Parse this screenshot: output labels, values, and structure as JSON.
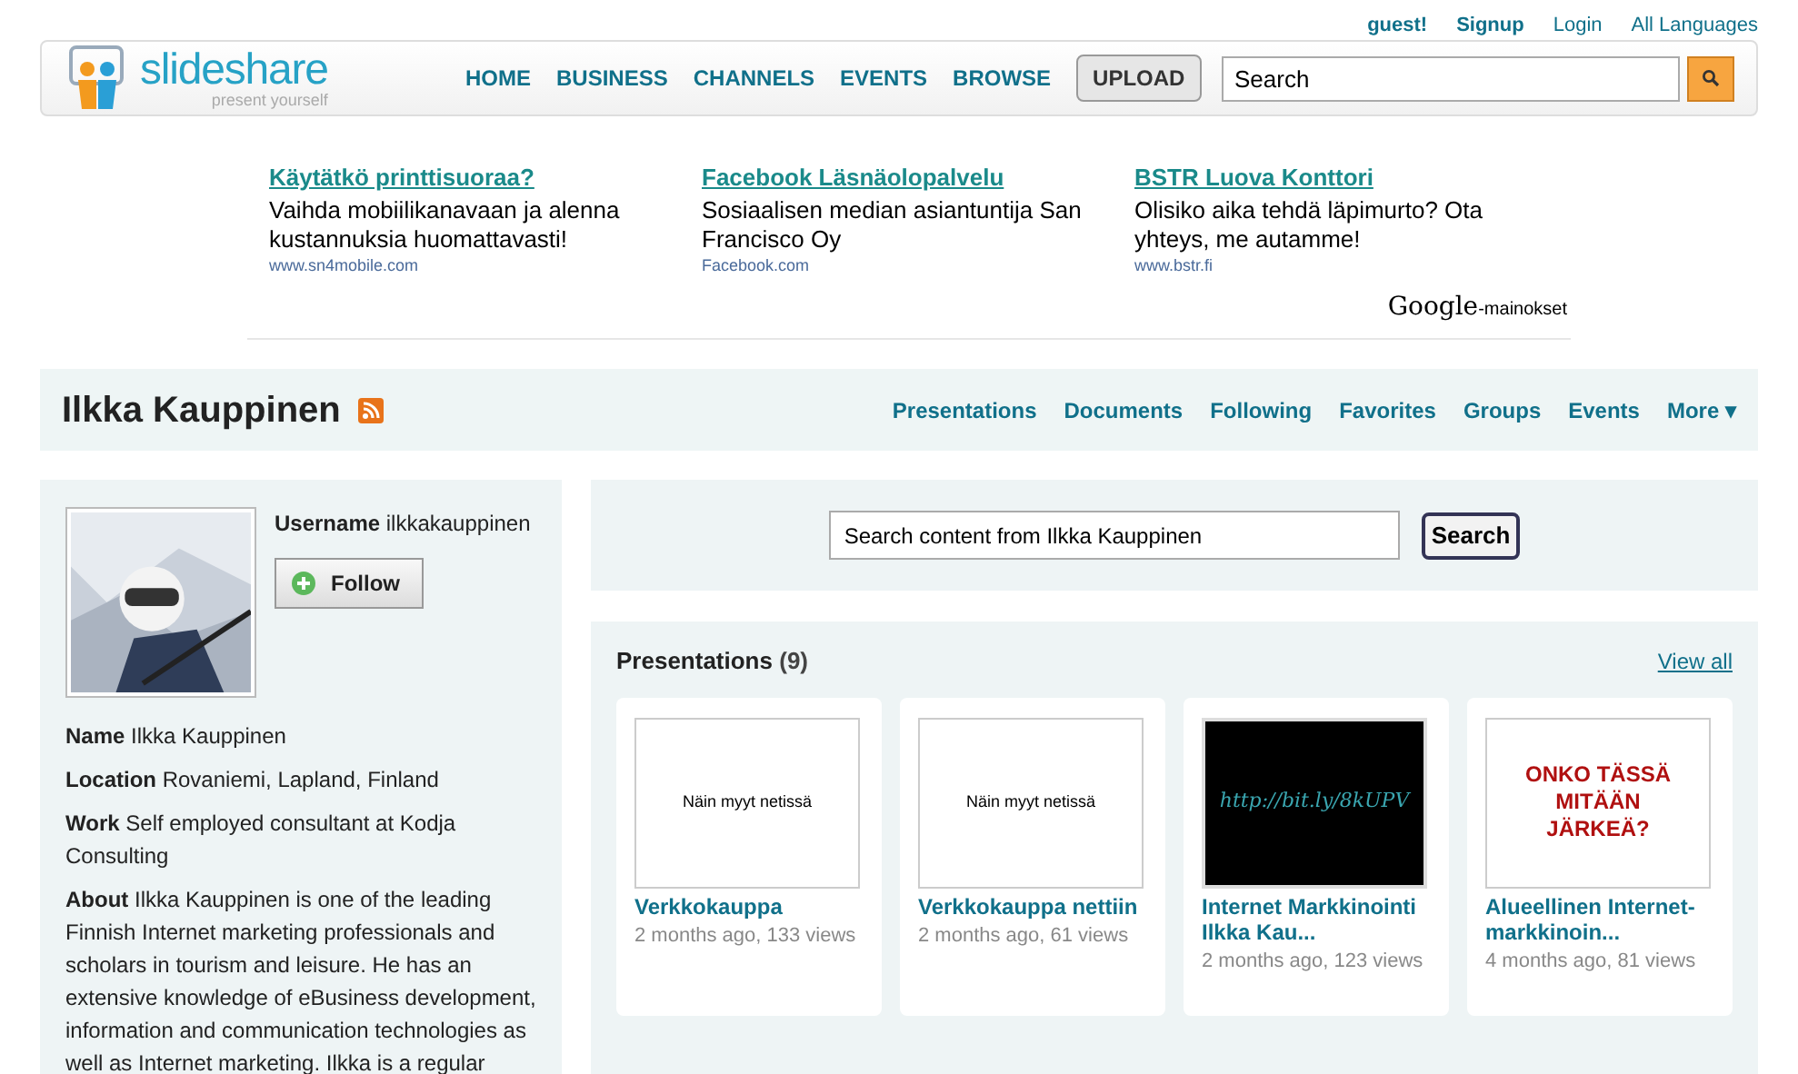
{
  "top_links": [
    {
      "label": "guest!",
      "kind": "bold"
    },
    {
      "label": "Signup",
      "kind": "bold"
    },
    {
      "label": "Login",
      "kind": "plain"
    },
    {
      "label": "All Languages",
      "kind": "plain"
    }
  ],
  "logo": {
    "name": "slideshare",
    "tagline": "present yourself"
  },
  "nav": [
    "HOME",
    "BUSINESS",
    "CHANNELS",
    "EVENTS",
    "BROWSE"
  ],
  "upload": "UPLOAD",
  "search": {
    "value": "Search"
  },
  "ads": [
    {
      "title": "Käytätkö printtisuoraa?",
      "text": "Vaihda mobiilikanavaan ja alenna kustannuksia huomattavasti!",
      "url": "www.sn4mobile.com"
    },
    {
      "title": "Facebook Läsnäolopalvelu",
      "text": "Sosiaalisen median asiantuntija San Francisco Oy",
      "url": "Facebook.com"
    },
    {
      "title": "BSTR Luova Konttori",
      "text": "Olisiko aika tehdä läpimurto? Ota yhteys, me autamme!",
      "url": "www.bstr.fi"
    }
  ],
  "ads_credit": {
    "brand": "Google",
    "suffix": "-mainokset"
  },
  "profile": {
    "name": "Ilkka Kauppinen",
    "tabs": [
      "Presentations",
      "Documents",
      "Following",
      "Favorites",
      "Groups",
      "Events",
      "More ▾"
    ]
  },
  "user": {
    "username_label": "Username",
    "username": "ilkkakauppinen",
    "follow": "Follow",
    "fields": [
      {
        "label": "Name",
        "value": "Ilkka Kauppinen"
      },
      {
        "label": "Location",
        "value": "Rovaniemi, Lapland, Finland"
      },
      {
        "label": "Work",
        "value": "Self employed consultant at Kodja Consulting"
      },
      {
        "label": "About",
        "value": "Ilkka Kauppinen is one of the leading Finnish Internet marketing professionals and scholars in tourism and leisure. He has an extensive knowledge of eBusiness development, information and communication technologies as well as Internet marketing. Ilkka is a regular"
      }
    ]
  },
  "content_search": {
    "value": "Search content from Ilkka Kauppinen",
    "button": "Search"
  },
  "presentations": {
    "title": "Presentations",
    "count": "(9)",
    "view_all": "View all",
    "items": [
      {
        "title": "Verkkokauppa",
        "meta": "2 months ago, 133 views",
        "slide": {
          "kind": "plain",
          "text": "Näin myyt netissä"
        }
      },
      {
        "title": "Verkkokauppa nettiin",
        "meta": "2 months ago, 61 views",
        "slide": {
          "kind": "plain",
          "text": "Näin myyt netissä"
        }
      },
      {
        "title": "Internet Markkinointi Ilkka Kau...",
        "meta": "2 months ago, 123 views",
        "slide": {
          "kind": "dark",
          "text": "http://bit.ly/8kUPV"
        }
      },
      {
        "title": "Alueellinen Internet-markkinoin...",
        "meta": "4 months ago, 81 views",
        "slide": {
          "kind": "headline",
          "text": "ONKO TÄSSÄ MITÄÄN JÄRKEÄ?"
        }
      }
    ]
  }
}
